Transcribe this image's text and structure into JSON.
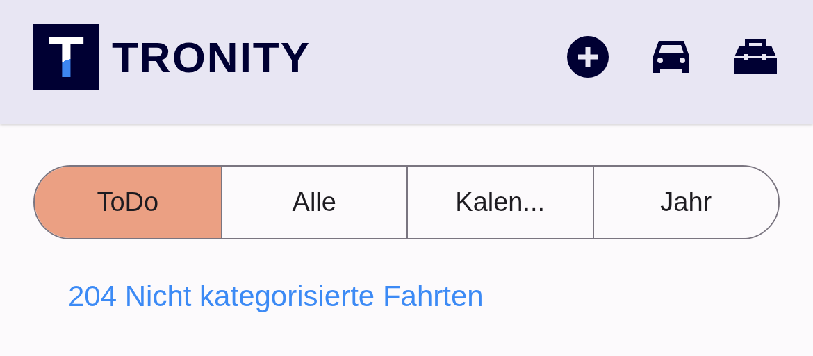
{
  "header": {
    "logo_mark": "T",
    "logo_text": "TRONITY",
    "actions": [
      {
        "kind": "add"
      },
      {
        "kind": "car"
      },
      {
        "kind": "toolbox"
      }
    ]
  },
  "tabs": [
    {
      "label": "ToDo",
      "selected": true
    },
    {
      "label": "Alle",
      "selected": false
    },
    {
      "label": "Kalen...",
      "selected": false
    },
    {
      "label": "Jahr",
      "selected": false
    }
  ],
  "link": "204 Nicht kategorisierte Fahrten"
}
